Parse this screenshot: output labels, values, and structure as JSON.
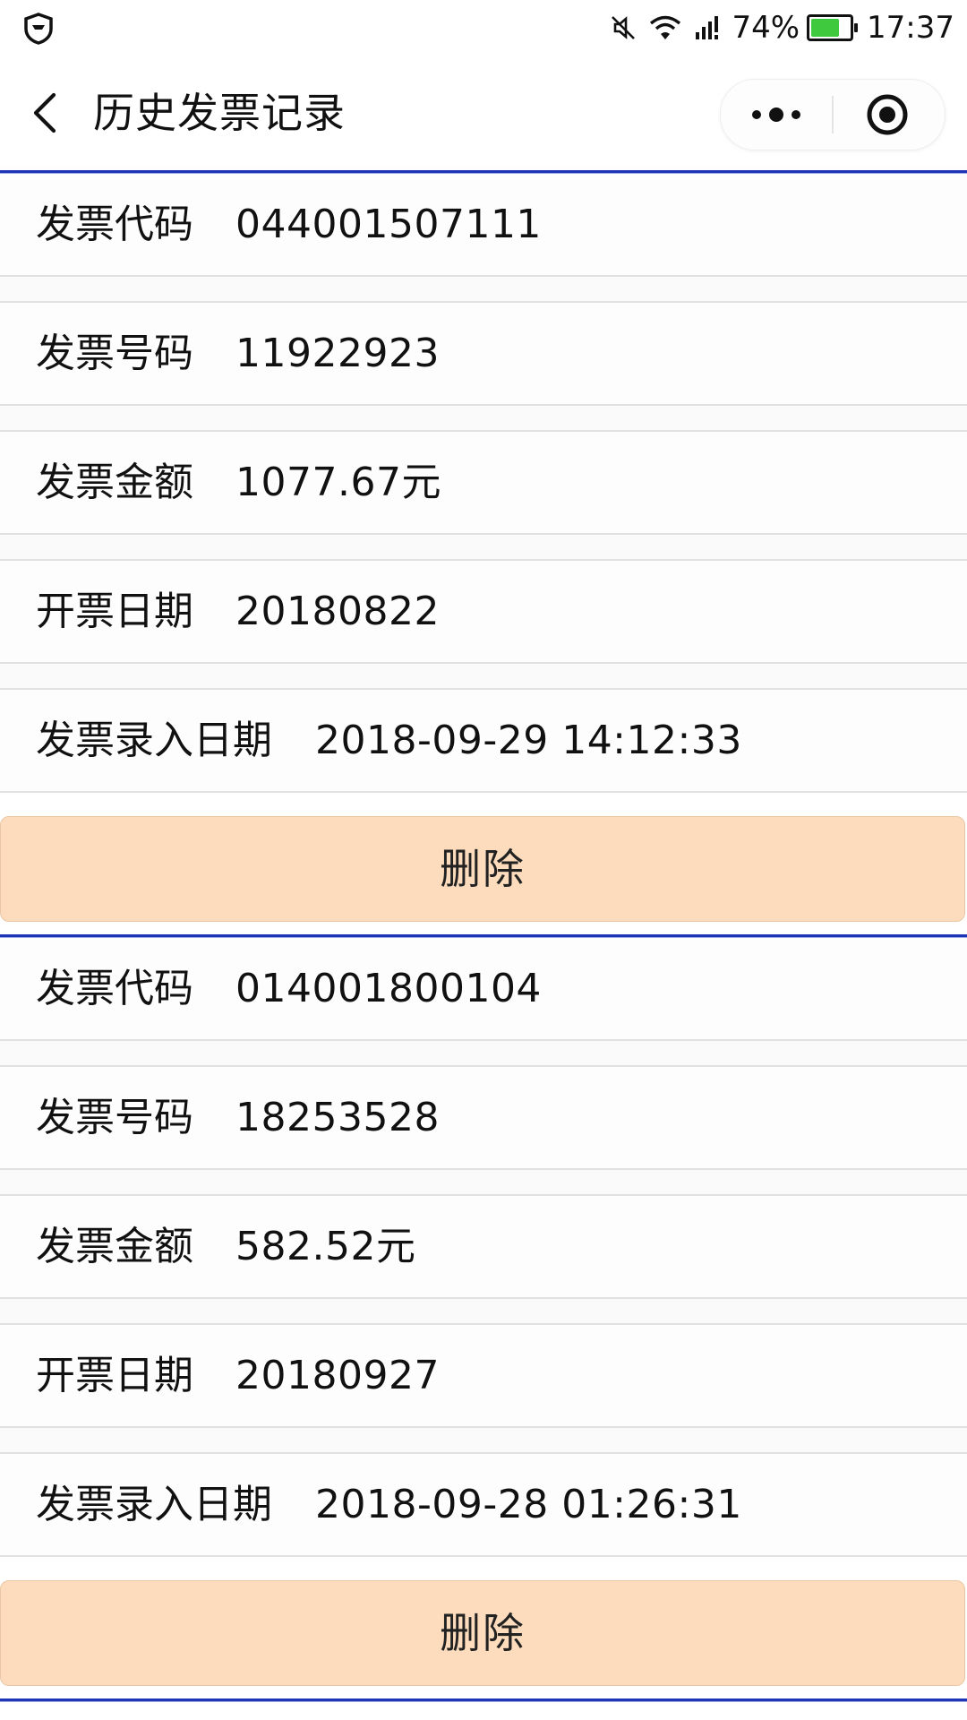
{
  "status_bar": {
    "icons": [
      "shield-icon",
      "mute-icon",
      "wifi-icon",
      "signal-icon"
    ],
    "battery_percent": "74%",
    "battery_level": 0.74,
    "battery_color": "#3ec93e",
    "time": "17:37"
  },
  "nav": {
    "title": "历史发票记录",
    "back_icon": "chevron-left-icon",
    "more_icon": "more-dots-icon",
    "close_icon": "target-close-icon"
  },
  "colors": {
    "separator_blue": "#1d35b4",
    "delete_bg": "#fcdcbc"
  },
  "records": [
    {
      "invoice_code_label": "发票代码",
      "invoice_code": "044001507111",
      "invoice_number_label": "发票号码",
      "invoice_number": "11922923",
      "amount_label": "发票金额",
      "amount": "1077.67元",
      "issue_date_label": "开票日期",
      "issue_date": "20180822",
      "entry_date_label": "发票录入日期",
      "entry_date": "2018-09-29 14:12:33",
      "delete_label": "删除"
    },
    {
      "invoice_code_label": "发票代码",
      "invoice_code": "014001800104",
      "invoice_number_label": "发票号码",
      "invoice_number": "18253528",
      "amount_label": "发票金额",
      "amount": "582.52元",
      "issue_date_label": "开票日期",
      "issue_date": "20180927",
      "entry_date_label": "发票录入日期",
      "entry_date": "2018-09-28 01:26:31",
      "delete_label": "删除"
    }
  ]
}
